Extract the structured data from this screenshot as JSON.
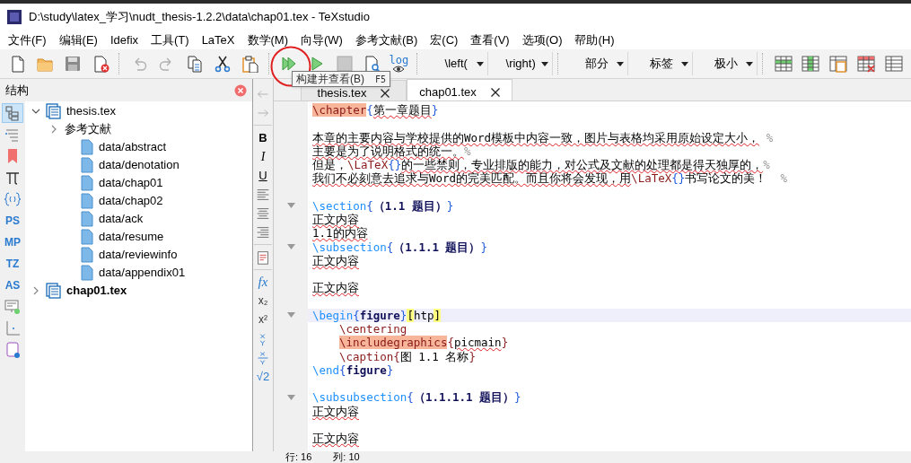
{
  "window": {
    "title": "D:\\study\\latex_学习\\nudt_thesis-1.2.2\\data\\chap01.tex - TeXstudio"
  },
  "menu": [
    "文件(F)",
    "编辑(E)",
    "Idefix",
    "工具(T)",
    "LaTeX",
    "数学(M)",
    "向导(W)",
    "参考文献(B)",
    "宏(C)",
    "查看(V)",
    "选项(O)",
    "帮助(H)"
  ],
  "toolbar": [
    {
      "kind": "new"
    },
    {
      "kind": "open"
    },
    {
      "kind": "save"
    },
    {
      "kind": "close_doc"
    },
    {
      "kind": "sep"
    },
    {
      "kind": "undo"
    },
    {
      "kind": "redo"
    },
    {
      "kind": "copy"
    },
    {
      "kind": "cut"
    },
    {
      "kind": "paste"
    },
    {
      "kind": "sep"
    },
    {
      "kind": "build_view"
    },
    {
      "kind": "compile"
    },
    {
      "kind": "stop"
    },
    {
      "kind": "view"
    },
    {
      "kind": "log",
      "text": "log"
    },
    {
      "kind": "sep"
    },
    {
      "kind": "dropdown",
      "text": "\\left("
    },
    {
      "kind": "dropdown",
      "text": "\\right)"
    },
    {
      "kind": "sep"
    },
    {
      "kind": "dropdown",
      "text": "部分"
    },
    {
      "kind": "dropdown",
      "text": "标签"
    },
    {
      "kind": "dropdown",
      "text": "极小"
    },
    {
      "kind": "sep"
    },
    {
      "kind": "table_rows"
    },
    {
      "kind": "table_cols"
    },
    {
      "kind": "table_paste"
    },
    {
      "kind": "table_delete"
    },
    {
      "kind": "table_more"
    }
  ],
  "tooltip": {
    "text": "构建并查看(B)",
    "shortcut": "F5"
  },
  "structure_panel": {
    "title": "结构",
    "side_tools": [
      {
        "kind": "structure",
        "selected": true
      },
      {
        "kind": "toc",
        "selected": false
      },
      {
        "kind": "bookmark",
        "selected": false
      },
      {
        "kind": "pi",
        "selected": false
      },
      {
        "kind": "braces",
        "selected": false
      },
      {
        "kind": "label",
        "text": "PS",
        "selected": false
      },
      {
        "kind": "label",
        "text": "MP",
        "selected": false
      },
      {
        "kind": "label",
        "text": "TZ",
        "selected": false
      },
      {
        "kind": "label",
        "text": "AS",
        "selected": false
      },
      {
        "kind": "screen",
        "selected": false
      },
      {
        "kind": "axes",
        "selected": false
      },
      {
        "kind": "script",
        "selected": false
      }
    ],
    "tree": [
      {
        "kind": "document",
        "label": "thesis.tex",
        "expanded": true,
        "bold": false,
        "children": [
          {
            "kind": "section",
            "label": "参考文献",
            "expanded": false
          },
          {
            "kind": "file",
            "label": "data/abstract"
          },
          {
            "kind": "file",
            "label": "data/denotation"
          },
          {
            "kind": "file",
            "label": "data/chap01"
          },
          {
            "kind": "file",
            "label": "data/chap02"
          },
          {
            "kind": "file",
            "label": "data/ack"
          },
          {
            "kind": "file",
            "label": "data/resume"
          },
          {
            "kind": "file",
            "label": "data/reviewinfo"
          },
          {
            "kind": "file",
            "label": "data/appendix01"
          }
        ]
      },
      {
        "kind": "document",
        "label": "chap01.tex",
        "expanded": false,
        "bold": true
      }
    ]
  },
  "editor_tools": [
    {
      "kind": "back"
    },
    {
      "kind": "forward"
    },
    {
      "kind": "sep"
    },
    {
      "kind": "bold",
      "text": "B"
    },
    {
      "kind": "italic",
      "text": "I"
    },
    {
      "kind": "underline",
      "text": "U"
    },
    {
      "kind": "align_left"
    },
    {
      "kind": "align_center"
    },
    {
      "kind": "align_right"
    },
    {
      "kind": "sep"
    },
    {
      "kind": "doc"
    },
    {
      "kind": "sep"
    },
    {
      "kind": "fx",
      "text": "fx"
    },
    {
      "kind": "text",
      "text": "x₂"
    },
    {
      "kind": "text",
      "text": "x²"
    },
    {
      "kind": "frac"
    },
    {
      "kind": "frac_line"
    },
    {
      "kind": "sqrt",
      "text": "√2"
    }
  ],
  "tabs": [
    {
      "label": "thesis.tex",
      "selected": false
    },
    {
      "label": "chap01.tex",
      "selected": true
    }
  ],
  "editor_lines": [
    {
      "fold": false,
      "current": false,
      "indented": false,
      "segments": [
        {
          "kind": "command_hl",
          "text": "\\chapter"
        },
        {
          "kind": "brace",
          "text": "{"
        },
        {
          "kind": "text",
          "text": "第一章题目",
          "squiggle": true
        },
        {
          "kind": "brace",
          "text": "}"
        }
      ]
    },
    {
      "fold": false,
      "current": false
    },
    {
      "fold": false,
      "current": false,
      "indented": false,
      "segments": [
        {
          "kind": "text",
          "text": "本章的主要内容与学校提供的Word模板中内容一致，图片与表格均采用原始设定大小，",
          "squiggle": true
        },
        {
          "kind": "comment",
          "text": " %"
        }
      ]
    },
    {
      "fold": false,
      "current": false,
      "indented": false,
      "segments": [
        {
          "kind": "text",
          "text": "主要是为了说明格式的统一。",
          "squiggle": true
        },
        {
          "kind": "comment",
          "text": "%"
        }
      ]
    },
    {
      "fold": false,
      "current": false,
      "indented": false,
      "segments": [
        {
          "kind": "text",
          "text": "但是，",
          "squiggle": false
        },
        {
          "kind": "latex",
          "text": "\\LaTeX"
        },
        {
          "kind": "brace",
          "text": "{}"
        },
        {
          "kind": "text",
          "text": "的一些禁则，专业排版的能力，对公式及文献的处理都是得天独厚的，",
          "squiggle": true
        },
        {
          "kind": "comment",
          "text": "%"
        }
      ]
    },
    {
      "fold": false,
      "current": false,
      "indented": false,
      "segments": [
        {
          "kind": "text",
          "text": "我们不必刻意去追求与Word的完美匹配。而且你将会发现，用",
          "squiggle": true
        },
        {
          "kind": "latex",
          "text": "\\LaTeX"
        },
        {
          "kind": "brace",
          "text": "{}"
        },
        {
          "kind": "text",
          "text": "书写论文的美！",
          "squiggle": false
        },
        {
          "kind": "comment",
          "text": "  %"
        }
      ]
    },
    {
      "fold": false,
      "current": false
    },
    {
      "fold": true,
      "current": false,
      "indented": false,
      "segments": [
        {
          "kind": "command",
          "text": "\\section"
        },
        {
          "kind": "brace",
          "text": "{"
        },
        {
          "kind": "arg",
          "text": "（1.1 题目）"
        },
        {
          "kind": "brace",
          "text": "}"
        }
      ]
    },
    {
      "fold": false,
      "current": false,
      "indented": false,
      "segments": [
        {
          "kind": "text",
          "text": "正文内容",
          "squiggle": true
        }
      ]
    },
    {
      "fold": false,
      "current": false,
      "indented": false,
      "segments": [
        {
          "kind": "text",
          "text": "1.1的内容",
          "squiggle": true
        }
      ]
    },
    {
      "fold": true,
      "current": false,
      "indented": false,
      "segments": [
        {
          "kind": "command",
          "text": "\\subsection"
        },
        {
          "kind": "brace",
          "text": "{"
        },
        {
          "kind": "arg",
          "text": "（1.1.1 题目）"
        },
        {
          "kind": "brace",
          "text": "}"
        }
      ]
    },
    {
      "fold": false,
      "current": false,
      "indented": false,
      "segments": [
        {
          "kind": "text",
          "text": "正文内容",
          "squiggle": true
        }
      ]
    },
    {
      "fold": false,
      "current": false
    },
    {
      "fold": false,
      "current": false,
      "indented": false,
      "segments": [
        {
          "kind": "text",
          "text": "正文内容",
          "squiggle": true
        }
      ]
    },
    {
      "fold": false,
      "current": false
    },
    {
      "fold": true,
      "current": true,
      "indented": false,
      "segments": [
        {
          "kind": "command",
          "text": "\\begin"
        },
        {
          "kind": "brace",
          "text": "{"
        },
        {
          "kind": "arg",
          "text": "figure"
        },
        {
          "kind": "brace",
          "text": "}"
        },
        {
          "kind": "bracket_hl",
          "text": "["
        },
        {
          "kind": "text",
          "text": "htp",
          "squiggle": false
        },
        {
          "kind": "bracket_hl",
          "text": "]"
        }
      ]
    },
    {
      "fold": false,
      "current": false,
      "indented": true,
      "segments": [
        {
          "kind": "latex",
          "text": "\\centering"
        }
      ]
    },
    {
      "fold": false,
      "current": false,
      "indented": true,
      "segments": [
        {
          "kind": "command_hl",
          "text": "\\includegraphics"
        },
        {
          "kind": "latex",
          "text": "{"
        },
        {
          "kind": "text",
          "text": "picmain",
          "squiggle": true
        },
        {
          "kind": "latex",
          "text": "}"
        }
      ]
    },
    {
      "fold": false,
      "current": false,
      "indented": true,
      "segments": [
        {
          "kind": "latex",
          "text": "\\caption{"
        },
        {
          "kind": "text",
          "text": "图 1.1 名称",
          "squiggle": false
        },
        {
          "kind": "latex",
          "text": "}"
        }
      ]
    },
    {
      "fold": false,
      "current": false,
      "indented": false,
      "segments": [
        {
          "kind": "command",
          "text": "\\end"
        },
        {
          "kind": "brace",
          "text": "{"
        },
        {
          "kind": "arg",
          "text": "figure"
        },
        {
          "kind": "brace",
          "text": "}"
        }
      ]
    },
    {
      "fold": false,
      "current": false
    },
    {
      "fold": true,
      "current": false,
      "indented": false,
      "segments": [
        {
          "kind": "command",
          "text": "\\subsubsection"
        },
        {
          "kind": "brace",
          "text": "{"
        },
        {
          "kind": "arg",
          "text": "（1.1.1.1 题目）"
        },
        {
          "kind": "brace",
          "text": "}"
        }
      ]
    },
    {
      "fold": false,
      "current": false,
      "indented": false,
      "segments": [
        {
          "kind": "text",
          "text": "正文内容",
          "squiggle": true
        }
      ]
    },
    {
      "fold": false,
      "current": false
    },
    {
      "fold": false,
      "current": false,
      "indented": false,
      "segments": [
        {
          "kind": "text",
          "text": "正文内容",
          "squiggle": true
        }
      ]
    }
  ],
  "status_bar": [
    "行: 16",
    "列: 10"
  ]
}
